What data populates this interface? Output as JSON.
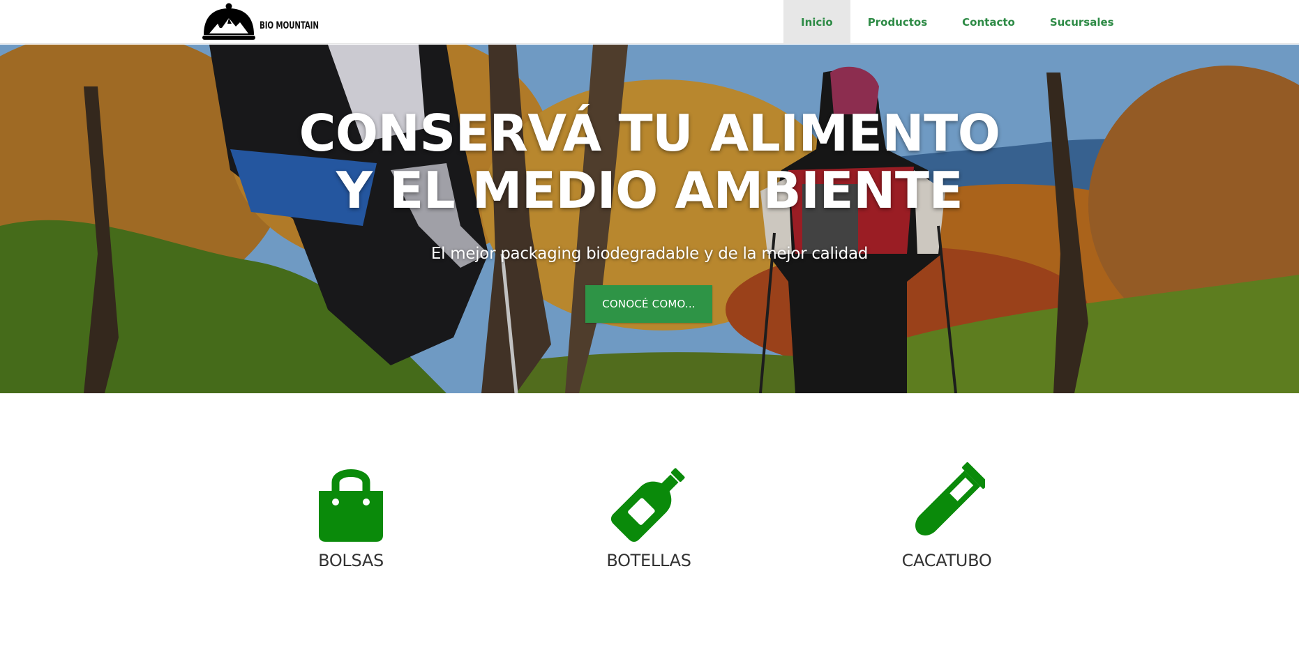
{
  "brand": {
    "name": "BIO MOUNTAIN",
    "logo_icon": "cloche-mountain-icon"
  },
  "nav": {
    "items": [
      {
        "label": "Inicio",
        "active": true
      },
      {
        "label": "Productos",
        "active": false
      },
      {
        "label": "Contacto",
        "active": false
      },
      {
        "label": "Sucursales",
        "active": false
      }
    ]
  },
  "hero": {
    "title_line1": "CONSERVÁ TU ALIMENTO",
    "title_line2": "Y EL MEDIO AMBIENTE",
    "subtitle": "El mejor packaging biodegradable y de la mejor calidad",
    "cta_label": "CONOCÉ COMO..."
  },
  "features": [
    {
      "label": "BOLSAS",
      "icon": "shopping-bag-icon"
    },
    {
      "label": "BOTELLAS",
      "icon": "bottle-icon"
    },
    {
      "label": "CACATUBO",
      "icon": "test-tube-icon"
    }
  ],
  "colors": {
    "accent": "#2e8b46",
    "button": "#2e9446",
    "icon": "#0a8a0a",
    "nav_active_bg": "#e7e7e7"
  }
}
